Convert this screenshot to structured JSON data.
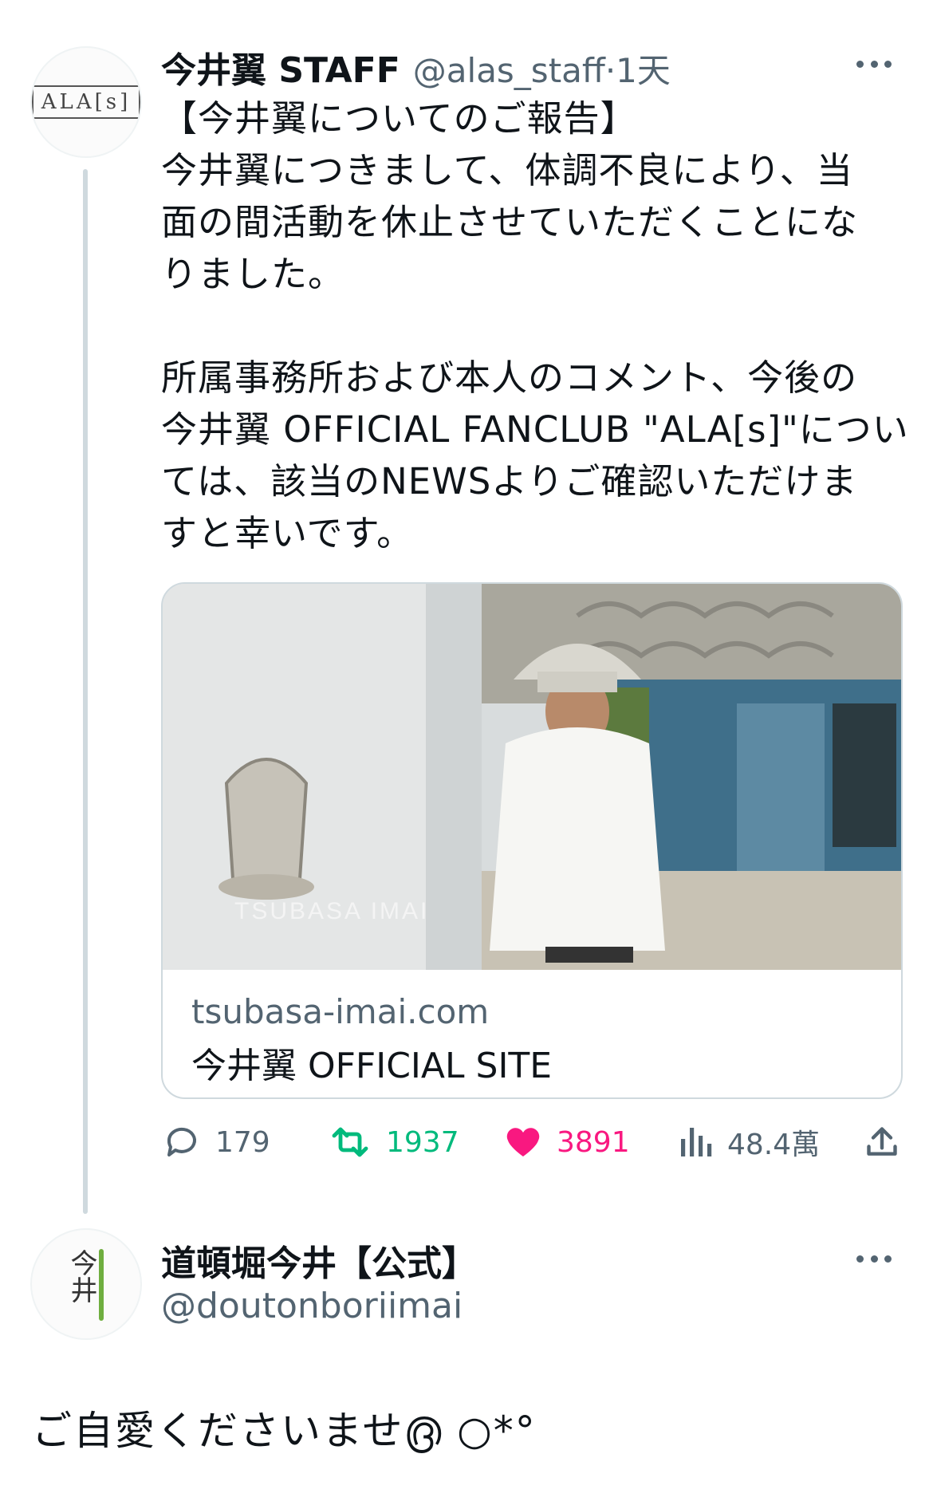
{
  "tweet": {
    "avatar_text": "ALA[s]",
    "author_name": "今井翼 STAFF",
    "handle_time": "@alas_staff·1天",
    "body": "【今井翼についてのご報告】\n今井翼につきまして、体調不良により、当\n面の間活動を休止させていただくことにな\nりました。\n\n所属事務所および本人のコメント、今後の\n今井翼 OFFICIAL FANCLUB \"ALA[s]\"につい\nては、該当のNEWSよりご確認いただけま\nすと幸いです。",
    "card": {
      "watermark": "TSUBASA IMAI",
      "domain": "tsubasa-imai.com",
      "title": "今井翼 OFFICIAL SITE"
    },
    "actions": {
      "replies": "179",
      "retweets": "1937",
      "likes": "3891",
      "views": "48.4萬"
    },
    "colors": {
      "retweet": "#00ba7c",
      "like": "#f91880",
      "muted": "#536471"
    }
  },
  "reply": {
    "avatar_text": "今井",
    "author_name": "道頓堀今井【公式】",
    "handle": "@doutonboriimai",
    "body": "ご自愛くださいませ൫ ○*°"
  }
}
